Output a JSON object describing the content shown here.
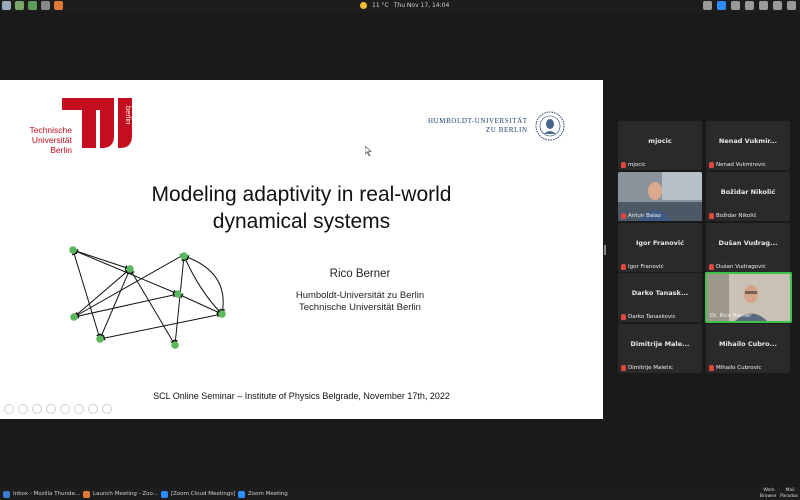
{
  "system_bar": {
    "weather": "11 °C",
    "datetime": "Thu Nov 17, 14:04"
  },
  "slide": {
    "tub_logo_text": [
      "Technische",
      "Universität",
      "Berlin"
    ],
    "tub_logo_vertical": "berlin",
    "hu_logo_text": [
      "HUMBOLDT-UNIVERSITÄT",
      "ZU BERLIN"
    ],
    "title_line1": "Modeling adaptivity in real-world",
    "title_line2": "dynamical systems",
    "author": "Rico Berner",
    "affiliation_line1": "Humboldt-Universität zu Berlin",
    "affiliation_line2": "Technische Universität Berlin",
    "footer": "SCL Online Seminar – Institute of Physics Belgrade, November 17th, 2022",
    "colors": {
      "tub_red": "#c40d1e",
      "hu_blue": "#1c3f72",
      "node_green": "#5cb85c"
    }
  },
  "participants": [
    {
      "display": "mjocic",
      "label": "mjocic",
      "video": false
    },
    {
      "display": "Nenad Vukmir...",
      "label": "Nenad Vukmirovic",
      "video": false
    },
    {
      "display": "",
      "label": "Antun Balaz",
      "video": true
    },
    {
      "display": "Božidar Nikolić",
      "label": "Božidar Nikolić",
      "video": false
    },
    {
      "display": "Igor Franović",
      "label": "Igor Franović",
      "video": false
    },
    {
      "display": "Dušan Vudrag...",
      "label": "Dušan Vudragović",
      "video": false
    },
    {
      "display": "Darko Tanask...",
      "label": "Darko Tanaskovic",
      "video": false
    },
    {
      "display": "",
      "label": "Dr. Rico Berner",
      "video": true
    },
    {
      "display": "Dimitrije Male...",
      "label": "Dimitrije Maletic",
      "video": false
    },
    {
      "display": "Mihailo Cubro...",
      "label": "Mihailo Cubrovic",
      "video": false
    }
  ],
  "taskbar": {
    "items": [
      "Inbox - Mozilla Thunde...",
      "Launch Meeting - Zoo...",
      "[Zoom Cloud Meetings]",
      "Zoom Meeting"
    ],
    "workspace": [
      "Work",
      "Mail",
      "Browse",
      "Paradox"
    ]
  }
}
